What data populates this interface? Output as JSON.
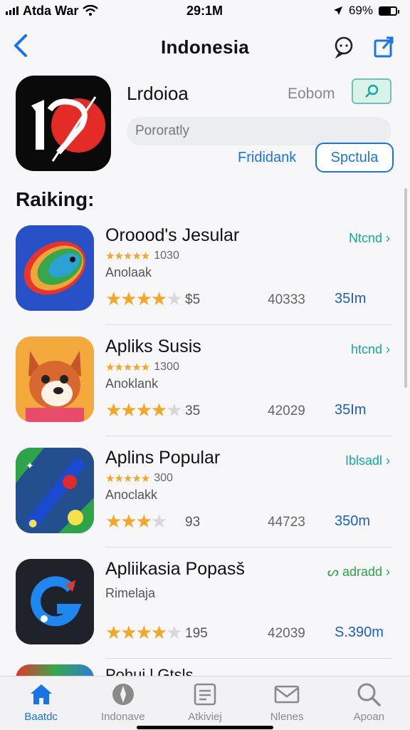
{
  "status": {
    "carrier": "Atda War",
    "time": "29:1M",
    "battery": "69%",
    "battery_level": 0.69
  },
  "nav": {
    "title": "Indonesia"
  },
  "featured": {
    "name": "Lrdoioa",
    "button_text": "Eobom",
    "input_placeholder": "Pororatly",
    "link": "Frididank",
    "outline_button": "Spctula"
  },
  "section_title": "Raiking:",
  "apps": [
    {
      "name": "Oroood's Jesular",
      "action": "Ntcnd ›",
      "mini_rating": "1030",
      "subtitle": "Anolaak",
      "stars": 4.5,
      "count": "$5",
      "mid": "40333",
      "size": "35Im"
    },
    {
      "name": "Apliks Susis",
      "action": "htcnd ›",
      "mini_rating": "1300",
      "subtitle": "Anoklank",
      "stars": 4,
      "count": "35",
      "mid": "42029",
      "size": "35Im"
    },
    {
      "name": "Aplins Popular",
      "action": "Iblsadl ›",
      "mini_rating": "300",
      "subtitle": "Anoclakk",
      "stars": 3.5,
      "count": "93",
      "mid": "44723",
      "size": "350m"
    },
    {
      "name": "Apliikasia Popasš",
      "action": "ᔕ adradd ›",
      "mini_rating": "",
      "subtitle": "Rimelaja",
      "stars": 4.5,
      "count": "195",
      "mid": "42039",
      "size": "S.390m"
    }
  ],
  "partial_item": "Pohui l Gtsls",
  "tabs": [
    {
      "label": "Baatdc",
      "icon": "home-icon",
      "active": true
    },
    {
      "label": "Indonave",
      "icon": "compass-icon",
      "active": false
    },
    {
      "label": "Atkiviej",
      "icon": "list-icon",
      "active": false
    },
    {
      "label": "Nlenes",
      "icon": "mail-icon",
      "active": false
    },
    {
      "label": "Apoan",
      "icon": "search-icon",
      "active": false
    }
  ],
  "colors": {
    "accent": "#1a73e8",
    "star": "#f5a623",
    "teal": "#13a89e"
  }
}
